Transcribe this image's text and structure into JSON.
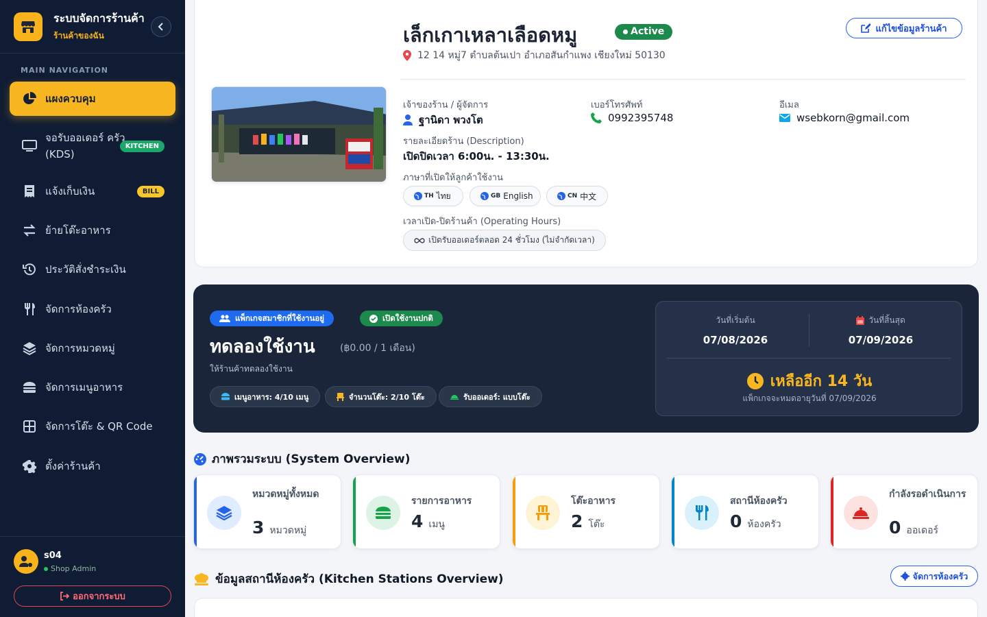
{
  "brand": {
    "title": "ระบบจัดการร้านค้า",
    "subtitle": "ร้านค้าของฉัน",
    "logo_icon": "store-icon",
    "collapse_icon": "chevron-left-icon",
    "accent": "#f7b21c"
  },
  "nav": {
    "header": "MAIN NAVIGATION",
    "items": [
      {
        "label": "แผงควบคุม",
        "icon": "chart-pie-icon",
        "active": true
      },
      {
        "label": "จอรับออเดอร์ ครัว (KDS)",
        "icon": "monitor-icon",
        "badge": "KITCHEN"
      },
      {
        "label": "แจ้งเก็บเงิน",
        "icon": "receipt-icon",
        "badge": "BILL"
      },
      {
        "label": "ย้ายโต๊ะอาหาร",
        "icon": "swap-icon"
      },
      {
        "label": "ประวัติสั่งชำระเงิน",
        "icon": "history-icon"
      },
      {
        "label": "จัดการห้องครัว",
        "icon": "utensils-icon"
      },
      {
        "label": "จัดการหมวดหมู่",
        "icon": "layers-icon"
      },
      {
        "label": "จัดการเมนูอาหาร",
        "icon": "burger-icon"
      },
      {
        "label": "จัดการโต๊ะ & QR Code",
        "icon": "grid-icon"
      },
      {
        "label": "ตั้งค่าร้านค้า",
        "icon": "gear-icon"
      }
    ]
  },
  "user": {
    "name": "s04",
    "role": "Shop Admin",
    "logout": "ออกจากระบบ"
  },
  "shop": {
    "name": "เล็กเกาเหลาเลือดหมู",
    "status": "Active",
    "address": "12 14 หมู่7 ตำบลต้นเปา อำเภอสันกำแพง เชียงใหม่ 50130",
    "edit_button": "แก้ไขข้อมูลร้านค้า",
    "photo_alt": "shop-photo",
    "owner_label": "เจ้าของร้าน / ผู้จัดการ",
    "owner": "ฐานิดา พวงโต",
    "phone_label": "เบอร์โทรศัพท์",
    "phone": "0992395748",
    "email_label": "อีเมล",
    "email": "wsebkorn@gmail.com",
    "desc_label": "รายละเอียดร้าน (Description)",
    "desc": "เปิดปิดเวลา 6:00น. - 13:30น.",
    "lang_label": "ภาษาที่เปิดให้ลูกค้าใช้งาน",
    "languages": [
      {
        "code": "TH",
        "label": "ไทย"
      },
      {
        "code": "GB",
        "label": "English"
      },
      {
        "code": "CN",
        "label": "中文"
      }
    ],
    "hours_label": "เวลาเปิด-ปิดร้านค้า (Operating Hours)",
    "hours": "เปิดรับออเดอร์ตลอด 24 ชั่วโมง (ไม่จำกัดเวลา)"
  },
  "package": {
    "badge_current": "แพ็กเกจสมาชิกที่ใช้งานอยู่",
    "badge_status": "เปิดใช้งานปกติ",
    "name": "ทดลองใช้งาน",
    "price": "(฿0.00 / 1 เดือน)",
    "desc": "ให้ร้านค้าทดลองใช้งาน",
    "stats": [
      {
        "label": "เมนูอาหาร: 4/10 เมนู",
        "icon": "food-icon"
      },
      {
        "label": "จำนวนโต๊ะ: 2/10 โต๊ะ",
        "icon": "chair-icon"
      },
      {
        "label": "รับออเดอร์: แบบโต๊ะ",
        "icon": "bell-icon"
      }
    ],
    "start_label": "วันที่เริ่มต้น",
    "start_date": "07/08/2026",
    "end_label": "วันที่สิ้นสุด",
    "end_date": "07/09/2026",
    "remaining": "เหลืออีก 14 วัน",
    "expiry_note": "แพ็กเกจจะหมดอายุวันที่ 07/09/2026"
  },
  "overview": {
    "title": "ภาพรวมระบบ (System Overview)",
    "cards": [
      {
        "label": "หมวดหมู่ทั้งหมด",
        "value": "3",
        "unit": "หมวดหมู่",
        "color": "#2563eb"
      },
      {
        "label": "รายการอาหาร",
        "value": "4",
        "unit": "เมนู",
        "color": "#16a34a"
      },
      {
        "label": "โต๊ะอาหาร",
        "value": "2",
        "unit": "โต๊ะ",
        "color": "#f59e0b"
      },
      {
        "label": "สถานีห้องครัว",
        "value": "0",
        "unit": "ห้องครัว",
        "color": "#0284c7"
      },
      {
        "label": "กำลังรอดำเนินการ",
        "value": "0",
        "unit": "ออเดอร์",
        "color": "#dc2626"
      }
    ]
  },
  "kitchen": {
    "title": "ข้อมูลสถานีห้องครัว (Kitchen Stations Overview)",
    "manage_button": "จัดการห้องครัว"
  }
}
